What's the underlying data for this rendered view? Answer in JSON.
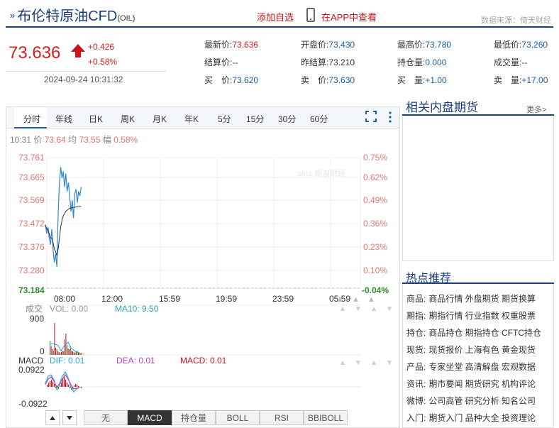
{
  "header": {
    "title": "布伦特原油CFD",
    "symbol": "(OIL)",
    "add_fav": "添加自选",
    "in_app": "在APP中查看",
    "source": "数据来源：倚天财经"
  },
  "quote": {
    "price": "73.636",
    "change": "+0.426",
    "change_pct": "+0.58%",
    "datetime": "2024-09-24 10:31:32"
  },
  "fields": [
    {
      "label": "最新价:",
      "value": "73.636",
      "color": "red"
    },
    {
      "label": "开盘价:",
      "value": "73.430",
      "color": "blue"
    },
    {
      "label": "最高价:",
      "value": "73.780",
      "color": "blue"
    },
    {
      "label": "最低价:",
      "value": "73.260",
      "color": "blue"
    },
    {
      "label": "结算价:",
      "value": "--",
      "color": "gray"
    },
    {
      "label": "昨结算:",
      "value": "73.210",
      "color": "gray"
    },
    {
      "label": "持仓量:",
      "value": "0.000",
      "color": "blue"
    },
    {
      "label": "成交量:",
      "value": "--",
      "color": "gray"
    },
    {
      "label": "买　价:",
      "value": "73.620",
      "color": "blue"
    },
    {
      "label": "卖　价:",
      "value": "73.630",
      "color": "blue"
    },
    {
      "label": "买　量:",
      "value": "+1.00",
      "color": "blue"
    },
    {
      "label": "卖　量:",
      "value": "+17.00",
      "color": "blue"
    }
  ],
  "tabs": [
    "分时",
    "年线",
    "日K",
    "周K",
    "月K",
    "年K",
    "5分",
    "15分",
    "30分",
    "60分"
  ],
  "infoline": {
    "time": "10:31",
    "price_label": "价",
    "price": "73.64",
    "avg_label": "均",
    "avg": "73.55",
    "amp_label": "幅",
    "amp": "0.58%"
  },
  "chart_data": {
    "type": "line",
    "y_left_ticks": [
      "73.761",
      "73.665",
      "73.569",
      "73.472",
      "73.376",
      "73.280"
    ],
    "y_right_ticks": [
      "0.75%",
      "0.62%",
      "0.49%",
      "0.36%",
      "0.23%",
      "0.10%"
    ],
    "y_base_left": "73.184",
    "y_base_right": "-0.04%",
    "x_ticks": [
      "08:00",
      "12:00",
      "15:59",
      "19:59",
      "23:59",
      "05:59"
    ],
    "ylim": [
      73.184,
      73.761
    ],
    "series": [
      {
        "values": [
          73.47,
          73.43,
          73.46,
          73.41,
          73.38,
          73.45,
          73.36,
          73.3,
          73.34,
          73.28,
          73.52,
          73.66,
          73.73,
          73.68,
          73.71,
          73.64,
          73.7,
          73.62,
          73.66,
          73.6,
          73.53,
          73.58,
          73.5,
          73.61,
          73.63,
          73.57,
          73.62,
          73.6,
          73.64
        ]
      },
      {
        "values": [
          73.47,
          73.45,
          73.45,
          73.43,
          73.41,
          73.41,
          73.39,
          73.36,
          73.35,
          73.33,
          73.36,
          73.41,
          73.46,
          73.49,
          73.51,
          73.52,
          73.53,
          73.535,
          73.54,
          73.545,
          73.545,
          73.547,
          73.548,
          73.549,
          73.55,
          73.55,
          73.551,
          73.552,
          73.553
        ]
      }
    ]
  },
  "volume": {
    "label": "成交",
    "vol": "VOL: 0.00",
    "ma": "MA10: 9.50",
    "top": "900",
    "bottom": "0"
  },
  "macd": {
    "label": "MACD",
    "dif": "DIF: 0.01",
    "dea": "DEA: 0.01",
    "macd": "MACD: 0.01",
    "top": "0.0922",
    "bottom": "-0.0922"
  },
  "bottom_tabs": [
    "无",
    "MACD",
    "持仓量",
    "BOLL",
    "RSI",
    "BBIBOLL"
  ],
  "related": {
    "title": "相关内盘期货",
    "more": "更多>"
  },
  "hot": {
    "title": "热点推荐",
    "rows": [
      {
        "k": "商品:",
        "v": "商品行情 外盘期货 期货换算"
      },
      {
        "k": "期指:",
        "v": "期指行情 行业指数 权重股票"
      },
      {
        "k": "持仓:",
        "v": "商品持仓 期指持仓 CFTC持仓"
      },
      {
        "k": "现货:",
        "v": "现货报价 上海有色 黄金现货"
      },
      {
        "k": "产品:",
        "v": "专家坐堂 高清解盘 宏观数据"
      },
      {
        "k": "资讯:",
        "v": "期市要闻 期货研究 机构评论"
      },
      {
        "k": "微博:",
        "v": "公司高管 研究分析 知名公司"
      },
      {
        "k": "入门:",
        "v": "期货入门 品种大全 投资理论"
      }
    ]
  }
}
